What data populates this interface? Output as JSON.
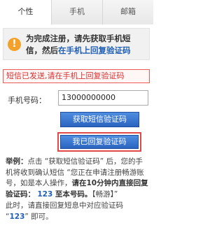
{
  "tabs": [
    {
      "label": "个性",
      "active": true
    },
    {
      "label": "手机",
      "active": false
    },
    {
      "label": "邮箱",
      "active": false
    }
  ],
  "notice": {
    "icon": "!",
    "line1": "为完成注册，请先获取手机短",
    "line2_prefix": "信，然后",
    "line2_link": "在手机上回复验证码"
  },
  "sent_message": "短信已发送,请在手机上回复验证码",
  "phone": {
    "label": "手机号码：",
    "value": "13000000000"
  },
  "buttons": {
    "get_sms": "获取短信验证码",
    "replied": "我已回复验证码"
  },
  "example": {
    "label": "举例：",
    "p1_a": "点击 “获取短信验证码” 后，您的手机将收到确认短信 “您正在申请注册畅游账号，如是本人操作，",
    "p1_bold_a": "请在10分钟内直接回复验证码：",
    "code": "123",
    "p1_bold_b": " 至本号码。",
    "p1_c": "【畅游】”",
    "p2_a": "此时，请直接回复短息中对应验证码 “",
    "p2_b": "” 即可。"
  },
  "colors": {
    "accent_blue": "#2a64c0",
    "link_blue": "#1f5fb6",
    "error_red": "#d93030",
    "warning_orange": "#f4a12c"
  }
}
